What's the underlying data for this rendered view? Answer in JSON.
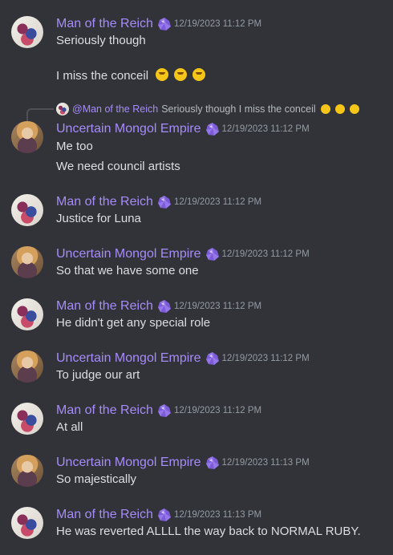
{
  "users": {
    "man": "Man of the Reich",
    "mongol": "Uncertain Mongol Empire"
  },
  "messages": [
    {
      "user": "Man of the Reich",
      "time": "12/19/2023 11:12 PM",
      "lines": [
        "Seriously though",
        "I miss the conceil"
      ]
    },
    {
      "user": "Uncertain Mongol Empire",
      "time": "12/19/2023 11:12 PM",
      "reply": {
        "mention": "@Man of the Reich",
        "text": "Seriously though I miss the conceil"
      },
      "lines": [
        "Me too",
        "We need council artists"
      ]
    },
    {
      "user": "Man of the Reich",
      "time": "12/19/2023 11:12 PM",
      "lines": [
        "Justice for Luna"
      ]
    },
    {
      "user": "Uncertain Mongol Empire",
      "time": "12/19/2023 11:12 PM",
      "lines": [
        "So that we have some one"
      ]
    },
    {
      "user": "Man of the Reich",
      "time": "12/19/2023 11:12 PM",
      "lines": [
        "He didn't get any special role"
      ]
    },
    {
      "user": "Uncertain Mongol Empire",
      "time": "12/19/2023 11:12 PM",
      "lines": [
        "To judge our art"
      ]
    },
    {
      "user": "Man of the Reich",
      "time": "12/19/2023 11:12 PM",
      "lines": [
        "At all"
      ]
    },
    {
      "user": "Uncertain Mongol Empire",
      "time": "12/19/2023 11:13 PM",
      "lines": [
        "So majestically"
      ]
    },
    {
      "user": "Man of the Reich",
      "time": "12/19/2023 11:13 PM",
      "lines": [
        "He was reverted ALLLL the way back to NORMAL RUBY."
      ]
    }
  ],
  "icons": {
    "badge": "purple-gem-badge-icon",
    "emoji": "hugging-face-emoji-icon"
  },
  "colors": {
    "background": "#313338",
    "username": "#a78bfa",
    "timestamp": "#949ba4",
    "text": "#dbdee1"
  }
}
